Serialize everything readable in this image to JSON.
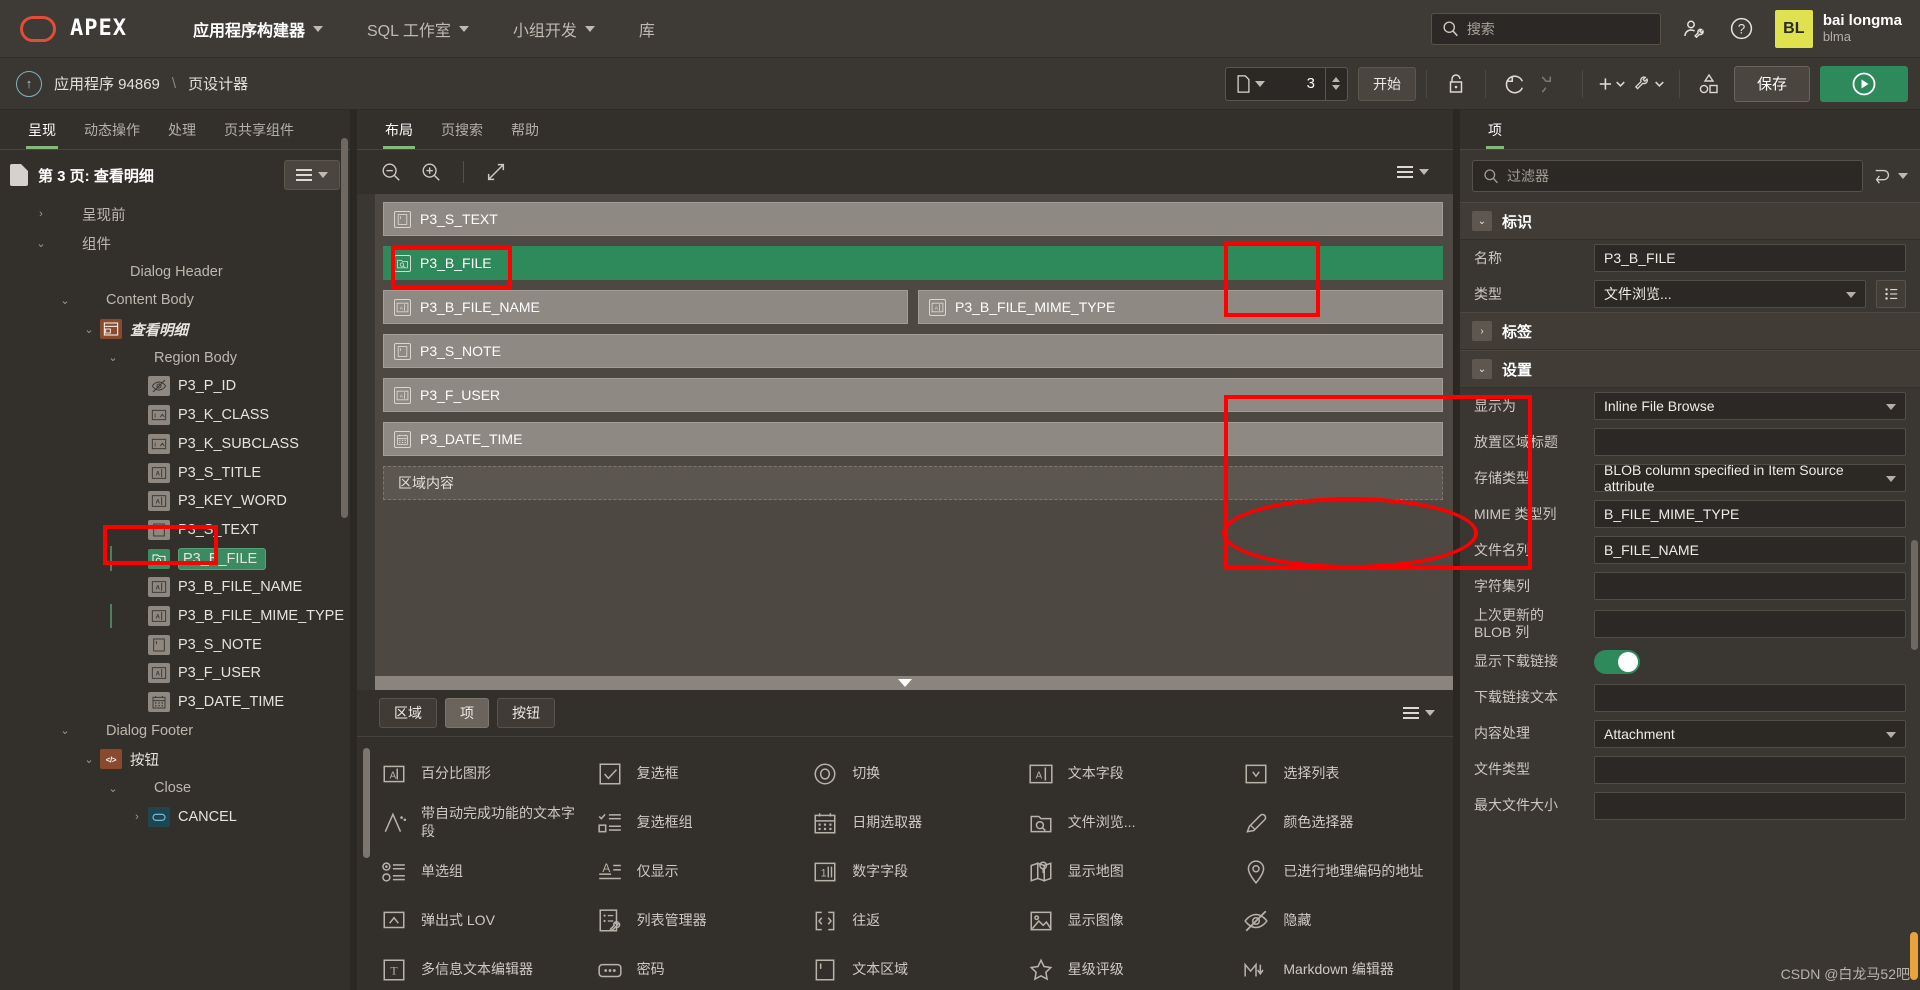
{
  "topnav": {
    "brand": "APEX",
    "items": [
      {
        "label": "应用程序构建器",
        "caret": true,
        "active": true
      },
      {
        "label": "SQL 工作室",
        "caret": true,
        "active": false
      },
      {
        "label": "小组开发",
        "caret": true,
        "active": false
      },
      {
        "label": "库",
        "caret": false,
        "active": false
      }
    ],
    "search_placeholder": "搜索",
    "icons": [
      "user-wrench-icon",
      "help-icon"
    ],
    "user": {
      "initials": "BL",
      "name": "bai longma",
      "id": "blma",
      "avatar_color": "#e0e14e"
    }
  },
  "toolbar": {
    "up_icon": "↑",
    "breadcrumb": [
      "应用程序 94869",
      "页设计器"
    ],
    "breadcrumb_sep": "\\",
    "page_number": "3",
    "start_label": "开始",
    "save_label": "保存",
    "icons": [
      "lock-icon",
      "undo-icon",
      "redo-icon",
      "plus-caret-icon",
      "wrench-caret-icon",
      "shapes-icon",
      "run-icon"
    ],
    "run_color": "#2f8a5b"
  },
  "left": {
    "tabs": [
      {
        "label": "呈现",
        "active": true
      },
      {
        "label": "动态操作",
        "active": false
      },
      {
        "label": "处理",
        "active": false
      },
      {
        "label": "页共享组件",
        "active": false
      }
    ],
    "tree_title": "第 3 页: 查看明细",
    "nodes": [
      {
        "label": "呈现前",
        "indent": 1,
        "tw": "›",
        "icon": "",
        "kind": "muted"
      },
      {
        "label": "组件",
        "indent": 1,
        "tw": "⌄",
        "icon": "",
        "kind": "muted"
      },
      {
        "label": "Dialog Header",
        "indent": 3,
        "tw": "",
        "icon": "",
        "kind": "muted"
      },
      {
        "label": "Content Body",
        "indent": 2,
        "tw": "⌄",
        "icon": "",
        "kind": "muted"
      },
      {
        "label": "查看明细",
        "indent": 3,
        "tw": "⌄",
        "icon": "region-icon",
        "kind": "italic"
      },
      {
        "label": "Region Body",
        "indent": 4,
        "tw": "⌄",
        "icon": "",
        "kind": "muted"
      },
      {
        "label": "P3_P_ID",
        "indent": 5,
        "tw": "",
        "icon": "hidden-icon",
        "kind": "normal"
      },
      {
        "label": "P3_K_CLASS",
        "indent": 5,
        "tw": "",
        "icon": "select-icon",
        "kind": "normal"
      },
      {
        "label": "P3_K_SUBCLASS",
        "indent": 5,
        "tw": "",
        "icon": "select-icon",
        "kind": "normal"
      },
      {
        "label": "P3_S_TITLE",
        "indent": 5,
        "tw": "",
        "icon": "text-field-icon",
        "kind": "normal"
      },
      {
        "label": "P3_KEY_WORD",
        "indent": 5,
        "tw": "",
        "icon": "text-field-icon",
        "kind": "normal"
      },
      {
        "label": "P3_S_TEXT",
        "indent": 5,
        "tw": "",
        "icon": "textarea-icon",
        "kind": "normal"
      },
      {
        "label": "P3_B_FILE",
        "indent": 5,
        "tw": "",
        "icon": "file-browse-icon",
        "kind": "selected"
      },
      {
        "label": "P3_B_FILE_NAME",
        "indent": 5,
        "tw": "",
        "icon": "text-field-icon",
        "kind": "normal"
      },
      {
        "label": "P3_B_FILE_MIME_TYPE",
        "indent": 5,
        "tw": "",
        "icon": "text-field-icon",
        "kind": "normal"
      },
      {
        "label": "P3_S_NOTE",
        "indent": 5,
        "tw": "",
        "icon": "textarea-icon",
        "kind": "normal"
      },
      {
        "label": "P3_F_USER",
        "indent": 5,
        "tw": "",
        "icon": "text-field-icon",
        "kind": "normal"
      },
      {
        "label": "P3_DATE_TIME",
        "indent": 5,
        "tw": "",
        "icon": "date-picker-icon",
        "kind": "normal"
      },
      {
        "label": "Dialog Footer",
        "indent": 2,
        "tw": "⌄",
        "icon": "",
        "kind": "muted"
      },
      {
        "label": "按钮",
        "indent": 3,
        "tw": "⌄",
        "icon": "code-icon",
        "kind": "bold"
      },
      {
        "label": "Close",
        "indent": 4,
        "tw": "⌄",
        "icon": "",
        "kind": "muted"
      },
      {
        "label": "CANCEL",
        "indent": 5,
        "tw": "›",
        "icon": "button-icon",
        "kind": "normal"
      }
    ]
  },
  "mid": {
    "tabs": [
      {
        "label": "布局",
        "active": true
      },
      {
        "label": "页搜索",
        "active": false
      },
      {
        "label": "帮助",
        "active": false
      }
    ],
    "tools": [
      "zoom-out-icon",
      "zoom-in-icon",
      "expand-icon"
    ],
    "canvas_rows": [
      [
        {
          "label": "P3_S_TEXT",
          "icon": "textarea-icon",
          "selected": false,
          "flex": 1
        }
      ],
      [
        {
          "label": "P3_B_FILE",
          "icon": "file-browse-icon",
          "selected": true,
          "flex": 1
        }
      ],
      [
        {
          "label": "P3_B_FILE_NAME",
          "icon": "text-field-icon",
          "selected": false,
          "flex": 1
        },
        {
          "label": "P3_B_FILE_MIME_TYPE",
          "icon": "text-field-icon",
          "selected": false,
          "flex": 1
        }
      ],
      [
        {
          "label": "P3_S_NOTE",
          "icon": "textarea-icon",
          "selected": false,
          "flex": 1
        }
      ],
      [
        {
          "label": "P3_F_USER",
          "icon": "text-field-icon",
          "selected": false,
          "flex": 1
        }
      ],
      [
        {
          "label": "P3_DATE_TIME",
          "icon": "date-picker-icon",
          "selected": false,
          "flex": 1
        }
      ]
    ],
    "region_content_label": "区域内容"
  },
  "gallery": {
    "tabs": [
      {
        "label": "区域",
        "active": false
      },
      {
        "label": "项",
        "active": true
      },
      {
        "label": "按钮",
        "active": false
      }
    ],
    "items": [
      {
        "label": "百分比图形",
        "icon": "percent-graph-icon"
      },
      {
        "label": "带自动完成功能的文本字段",
        "icon": "autocomplete-icon"
      },
      {
        "label": "单选组",
        "icon": "radio-group-icon"
      },
      {
        "label": "弹出式 LOV",
        "icon": "popup-lov-icon"
      },
      {
        "label": "多信息文本编辑器",
        "icon": "rich-text-editor-icon"
      },
      {
        "label": "复选框",
        "icon": "checkbox-icon"
      },
      {
        "label": "复选框组",
        "icon": "checkbox-group-icon"
      },
      {
        "label": "仅显示",
        "icon": "display-only-icon"
      },
      {
        "label": "列表管理器",
        "icon": "list-manager-icon"
      },
      {
        "label": "密码",
        "icon": "password-icon"
      },
      {
        "label": "切换",
        "icon": "switch-icon"
      },
      {
        "label": "日期选取器",
        "icon": "date-picker-icon"
      },
      {
        "label": "数字字段",
        "icon": "number-field-icon"
      },
      {
        "label": "往返",
        "icon": "shuttle-icon"
      },
      {
        "label": "文本区域",
        "icon": "textarea-icon"
      },
      {
        "label": "文本字段",
        "icon": "text-field-icon"
      },
      {
        "label": "文件浏览...",
        "icon": "file-browse-icon"
      },
      {
        "label": "显示地图",
        "icon": "display-map-icon"
      },
      {
        "label": "显示图像",
        "icon": "display-image-icon"
      },
      {
        "label": "星级评级",
        "icon": "star-rating-icon"
      },
      {
        "label": "选择列表",
        "icon": "select-list-icon"
      },
      {
        "label": "颜色选择器",
        "icon": "color-picker-icon"
      },
      {
        "label": "已进行地理编码的地址",
        "icon": "geocoded-address-icon"
      },
      {
        "label": "隐藏",
        "icon": "hidden-icon"
      },
      {
        "label": "Markdown 编辑器",
        "icon": "markdown-editor-icon"
      }
    ]
  },
  "right": {
    "tab": "项",
    "filter_placeholder": "过滤器",
    "sections": [
      {
        "title": "标识",
        "expanded": true,
        "rows": [
          {
            "label": "名称",
            "value": "P3_B_FILE",
            "kind": "text"
          },
          {
            "label": "类型",
            "value": "文件浏览...",
            "kind": "select-lov"
          }
        ]
      },
      {
        "title": "标签",
        "expanded": false,
        "rows": []
      },
      {
        "title": "设置",
        "expanded": true,
        "rows": [
          {
            "label": "显示为",
            "value": "Inline File Browse",
            "kind": "select"
          },
          {
            "label": "放置区域标题",
            "value": "",
            "kind": "text"
          },
          {
            "label": "存储类型",
            "value": "BLOB column specified in Item Source attribute",
            "kind": "select"
          },
          {
            "label": "MIME 类型列",
            "value": "B_FILE_MIME_TYPE",
            "kind": "text"
          },
          {
            "label": "文件名列",
            "value": "B_FILE_NAME",
            "kind": "text"
          },
          {
            "label": "字符集列",
            "value": "",
            "kind": "text"
          },
          {
            "label": "上次更新的 BLOB 列",
            "value": "",
            "kind": "text"
          },
          {
            "label": "显示下载链接",
            "value": "on",
            "kind": "toggle"
          },
          {
            "label": "下载链接文本",
            "value": "",
            "kind": "text"
          },
          {
            "label": "内容处理",
            "value": "Attachment",
            "kind": "select"
          },
          {
            "label": "文件类型",
            "value": "",
            "kind": "text"
          },
          {
            "label": "最大文件大小",
            "value": "",
            "kind": "text"
          }
        ]
      }
    ]
  },
  "watermark": "CSDN @白龙马52吧"
}
